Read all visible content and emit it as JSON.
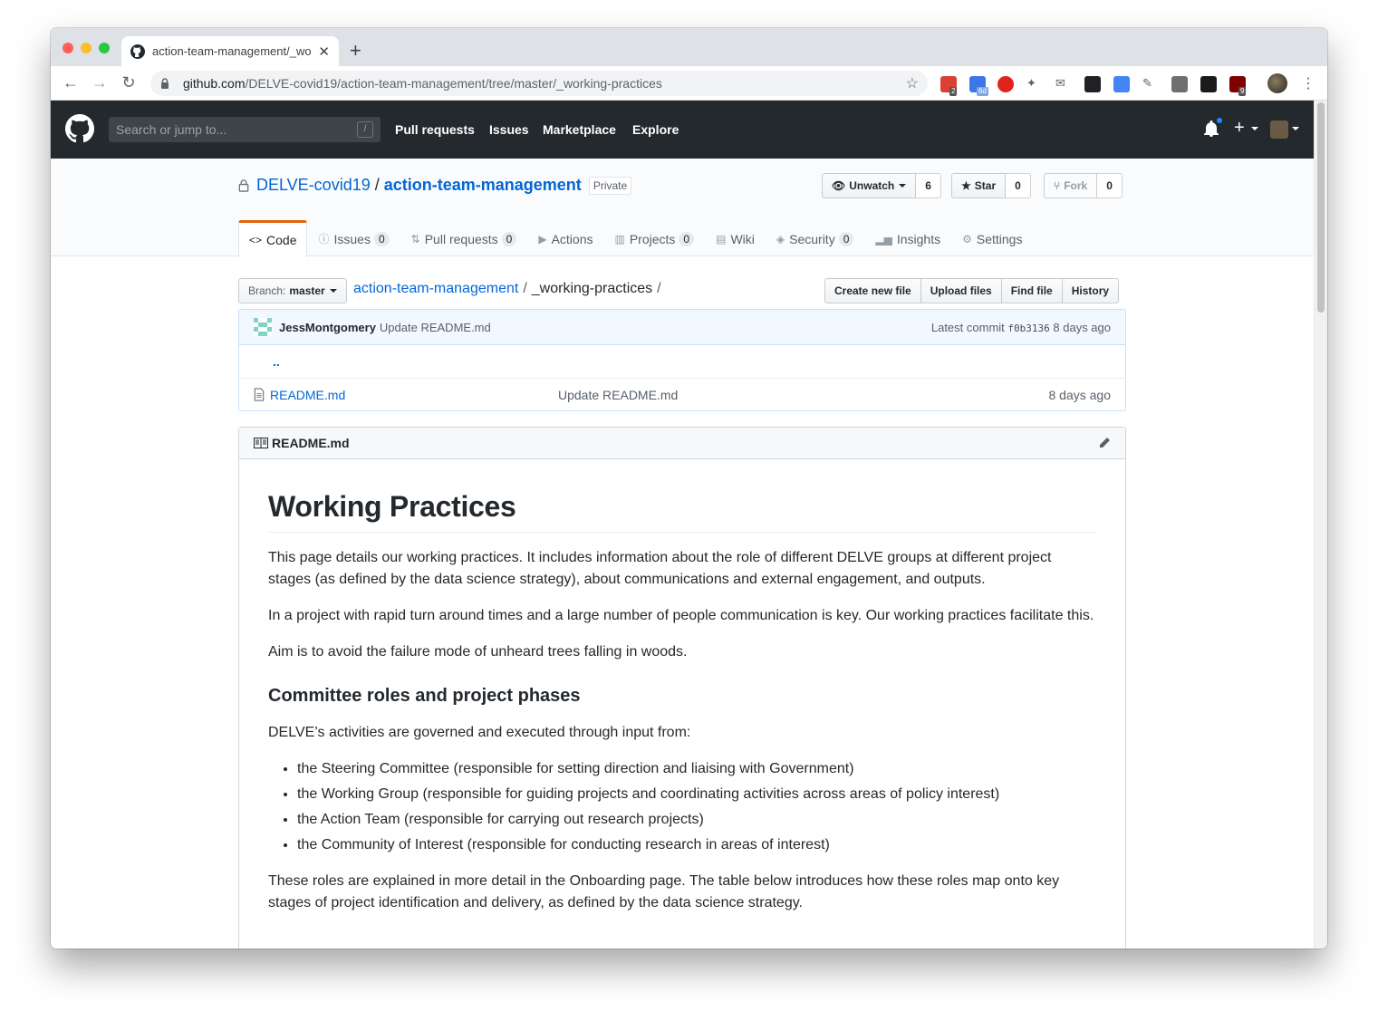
{
  "browser": {
    "tab_title": "action-team-management/_wo",
    "url_host": "github.com",
    "url_path": "/DELVE-covid19/action-team-management/tree/master/_working-practices",
    "extension_badges": [
      "2",
      "6d",
      "9"
    ]
  },
  "github": {
    "search_placeholder": "Search or jump to...",
    "search_shortcut": "/",
    "nav": [
      "Pull requests",
      "Issues",
      "Marketplace",
      "Explore"
    ]
  },
  "repo": {
    "owner": "DELVE-covid19",
    "name": "action-team-management",
    "visibility": "Private",
    "watch_label": "Unwatch",
    "watch_count": "6",
    "star_label": "Star",
    "star_count": "0",
    "fork_label": "Fork",
    "fork_count": "0",
    "tabs": [
      {
        "label": "Code",
        "icon": "code-icon",
        "counter": null
      },
      {
        "label": "Issues",
        "icon": "issue-icon",
        "counter": "0"
      },
      {
        "label": "Pull requests",
        "icon": "pull-request-icon",
        "counter": "0"
      },
      {
        "label": "Actions",
        "icon": "play-icon",
        "counter": null
      },
      {
        "label": "Projects",
        "icon": "project-icon",
        "counter": "0"
      },
      {
        "label": "Wiki",
        "icon": "book-icon",
        "counter": null
      },
      {
        "label": "Security",
        "icon": "shield-icon",
        "counter": "0"
      },
      {
        "label": "Insights",
        "icon": "graph-icon",
        "counter": null
      },
      {
        "label": "Settings",
        "icon": "gear-icon",
        "counter": null
      }
    ]
  },
  "filenav": {
    "branch_prefix": "Branch:",
    "branch": "master",
    "crumb_repo": "action-team-management",
    "crumb_dir": "_working-practices",
    "slash": "/",
    "buttons": [
      "Create new file",
      "Upload files",
      "Find file",
      "History"
    ]
  },
  "commit": {
    "author": "JessMontgomery",
    "message": "Update README.md",
    "latest_label": "Latest commit",
    "sha": "f0b3136",
    "age": "8 days ago"
  },
  "files": {
    "parent": "..",
    "rows": [
      {
        "name": "README.md",
        "message": "Update README.md",
        "age": "8 days ago"
      }
    ]
  },
  "readme": {
    "filename": "README.md",
    "h1": "Working Practices",
    "p1": "This page details our working practices. It includes information about the role of different DELVE groups at different project stages (as defined by the data science strategy), about communications and external engagement, and outputs.",
    "p2": "In a project with rapid turn around times and a large number of people communication is key. Our working practices facilitate this.",
    "p3": "Aim is to avoid the failure mode of unheard trees falling in woods.",
    "h3": "Committee roles and project phases",
    "p4": "DELVE’s activities are governed and executed through input from:",
    "list": [
      "the Steering Committee (responsible for setting direction and liaising with Government)",
      "the Working Group (responsible for guiding projects and coordinating activities across areas of policy interest)",
      "the Action Team (responsible for carrying out research projects)",
      "the Community of Interest (responsible for conducting research in areas of interest)"
    ],
    "p5": "These roles are explained in more detail in the Onboarding page. The table below introduces how these roles map onto key stages of project identification and delivery, as defined by the data science strategy."
  },
  "colors": {
    "gh_header": "#24292e",
    "link": "#0366d6",
    "active_tab_accent": "#e36209",
    "commit_bar": "#f1f8ff"
  }
}
